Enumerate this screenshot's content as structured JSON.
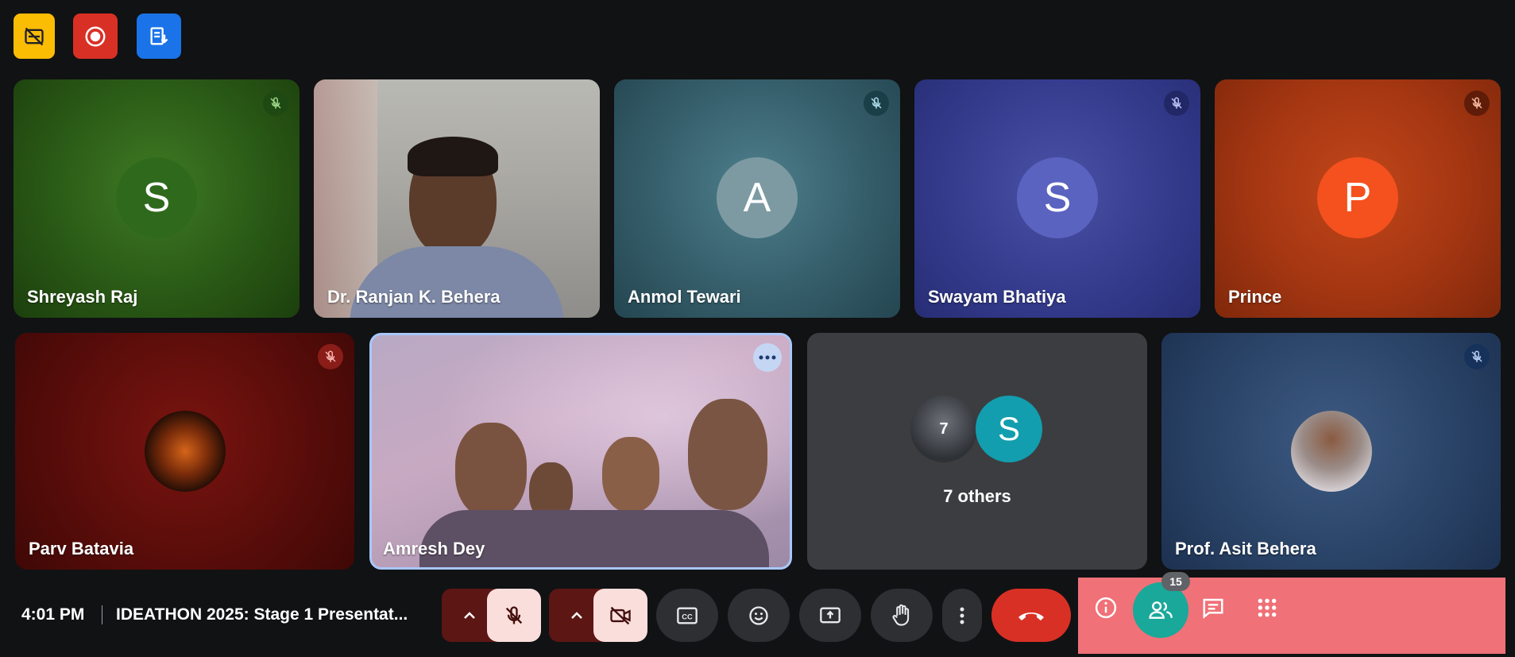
{
  "top_icons": [
    {
      "name": "captions-off-icon",
      "color": "#fbbc04"
    },
    {
      "name": "recording-icon",
      "color": "#d93025"
    },
    {
      "name": "transcript-icon",
      "color": "#1a73e8"
    }
  ],
  "participants_row1": [
    {
      "name": "Shreyash Raj",
      "initial": "S",
      "muted": true
    },
    {
      "name": "Dr. Ranjan K. Behera",
      "muted": false
    },
    {
      "name": "Anmol Tewari",
      "initial": "A",
      "muted": true
    },
    {
      "name": "Swayam Bhatiya",
      "initial": "S",
      "muted": true
    },
    {
      "name": "Prince",
      "initial": "P",
      "muted": true
    }
  ],
  "participants_row2": [
    {
      "name": "Parv Batavia",
      "muted": true
    },
    {
      "name": "Amresh Dey",
      "muted": false
    },
    {
      "name": "others",
      "label": "7 others",
      "initial": "S"
    },
    {
      "name": "Prof. Asit Behera",
      "muted": true
    }
  ],
  "bottom_bar": {
    "time": "4:01 PM",
    "meeting_title": "IDEATHON 2025: Stage 1 Presentat...",
    "people_count": "15"
  },
  "colors": {
    "end_call": "#d93025",
    "people_active": "#1aa89a",
    "right_panel_highlight": "#f07178",
    "mic_off_bg": "#f9dedc",
    "dropdown_bg": "#5c1614"
  }
}
